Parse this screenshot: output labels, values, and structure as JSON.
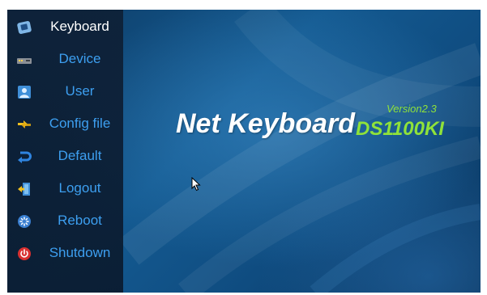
{
  "sidebar": {
    "items": [
      {
        "label": "Keyboard",
        "icon": "keyboard-icon",
        "active": true
      },
      {
        "label": "Device",
        "icon": "device-icon",
        "active": false
      },
      {
        "label": "User",
        "icon": "user-icon",
        "active": false
      },
      {
        "label": "Config file",
        "icon": "config-file-icon",
        "active": false
      },
      {
        "label": "Default",
        "icon": "default-icon",
        "active": false
      },
      {
        "label": "Logout",
        "icon": "logout-icon",
        "active": false
      },
      {
        "label": "Reboot",
        "icon": "reboot-icon",
        "active": false
      },
      {
        "label": "Shutdown",
        "icon": "shutdown-icon",
        "active": false
      }
    ]
  },
  "title": {
    "main": "Net Keyboard",
    "model": "DS1100KI",
    "version": "Version2.3"
  },
  "colors": {
    "accent": "#3d9ff0",
    "active_label": "#ffffff",
    "model_green": "#8fe23a"
  }
}
